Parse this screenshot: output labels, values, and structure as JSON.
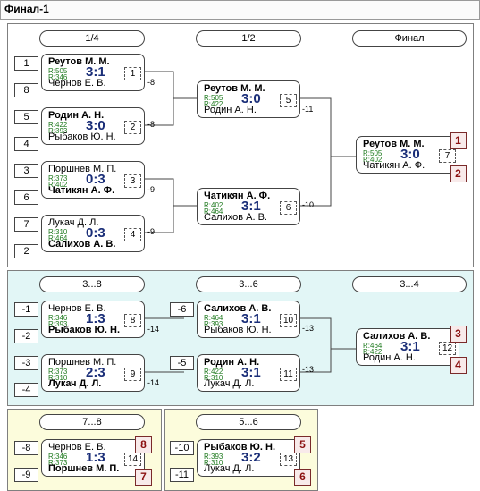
{
  "window": {
    "title": "Финал-1"
  },
  "sections": {
    "final": {
      "headers": [
        "1/4",
        "1/2",
        "Финал"
      ],
      "seeds": [
        "1",
        "8",
        "5",
        "4",
        "3",
        "6",
        "7",
        "2"
      ],
      "matches": [
        {
          "p1": "Реутов М. М.",
          "p2": "Чернов Е. В.",
          "r1": "R:505",
          "r2": "R:346",
          "score": "3:1",
          "match": "1",
          "winner": 1,
          "ref": "-8"
        },
        {
          "p1": "Родин А. Н.",
          "p2": "Рыбаков Ю. Н.",
          "r1": "R:422",
          "r2": "R:393",
          "score": "3:0",
          "match": "2",
          "winner": 1,
          "ref": "-8"
        },
        {
          "p1": "Поршнев М. П.",
          "p2": "Чатикян А. Ф.",
          "r1": "R:373",
          "r2": "R:402",
          "score": "0:3",
          "match": "3",
          "winner": 2,
          "ref": "-9"
        },
        {
          "p1": "Лукач Д. Л.",
          "p2": "Салихов А. В.",
          "r1": "R:310",
          "r2": "R:464",
          "score": "0:3",
          "match": "4",
          "winner": 2,
          "ref": "-9"
        },
        {
          "p1": "Реутов М. М.",
          "p2": "Родин А. Н.",
          "r1": "R:505",
          "r2": "R:422",
          "score": "3:0",
          "match": "5",
          "winner": 1,
          "ref": "-11"
        },
        {
          "p1": "Чатикян А. Ф.",
          "p2": "Салихов А. В.",
          "r1": "R:402",
          "r2": "R:464",
          "score": "3:1",
          "match": "6",
          "winner": 1,
          "ref": "-10"
        },
        {
          "p1": "Реутов М. М.",
          "p2": "Чатикян А. Ф.",
          "r1": "R:505",
          "r2": "R:402",
          "score": "3:0",
          "match": "7",
          "winner": 1
        }
      ],
      "places": [
        "1",
        "2"
      ]
    },
    "places_3_8": {
      "headers": [
        "3...8",
        "3...6",
        "3...4"
      ],
      "seeds": [
        "-1",
        "-2",
        "-3",
        "-4",
        "-6",
        "-5"
      ],
      "matches": [
        {
          "p1": "Чернов Е. В.",
          "p2": "Рыбаков Ю. Н.",
          "r1": "R:346",
          "r2": "R:393",
          "score": "1:3",
          "match": "8",
          "winner": 2,
          "ref": "-14"
        },
        {
          "p1": "Поршнев М. П.",
          "p2": "Лукач Д. Л.",
          "r1": "R:373",
          "r2": "R:310",
          "score": "2:3",
          "match": "9",
          "winner": 2,
          "ref": "-14"
        },
        {
          "p1": "Салихов А. В.",
          "p2": "Рыбаков Ю. Н.",
          "r1": "R:464",
          "r2": "R:393",
          "score": "3:1",
          "match": "10",
          "winner": 1,
          "ref": "-13"
        },
        {
          "p1": "Родин А. Н.",
          "p2": "Лукач Д. Л.",
          "r1": "R:422",
          "r2": "R:310",
          "score": "3:1",
          "match": "11",
          "winner": 1,
          "ref": "-13"
        },
        {
          "p1": "Салихов А. В.",
          "p2": "Родин А. Н.",
          "r1": "R:464",
          "r2": "R:422",
          "score": "3:1",
          "match": "12",
          "winner": 1
        }
      ],
      "places": [
        "3",
        "4"
      ]
    },
    "places_7_8": {
      "header": "7...8",
      "seeds": [
        "-8",
        "-9"
      ],
      "match": {
        "p1": "Чернов Е. В.",
        "p2": "Поршнев М. П.",
        "r1": "R:346",
        "r2": "R:373",
        "score": "1:3",
        "match": "14",
        "winner": 2
      },
      "places": [
        "8",
        "7"
      ]
    },
    "places_5_6": {
      "header": "5...6",
      "seeds": [
        "-10",
        "-11"
      ],
      "match": {
        "p1": "Рыбаков Ю. Н.",
        "p2": "Лукач Д. Л.",
        "r1": "R:393",
        "r2": "R:310",
        "score": "3:2",
        "match": "13",
        "winner": 1
      },
      "places": [
        "5",
        "6"
      ]
    }
  }
}
